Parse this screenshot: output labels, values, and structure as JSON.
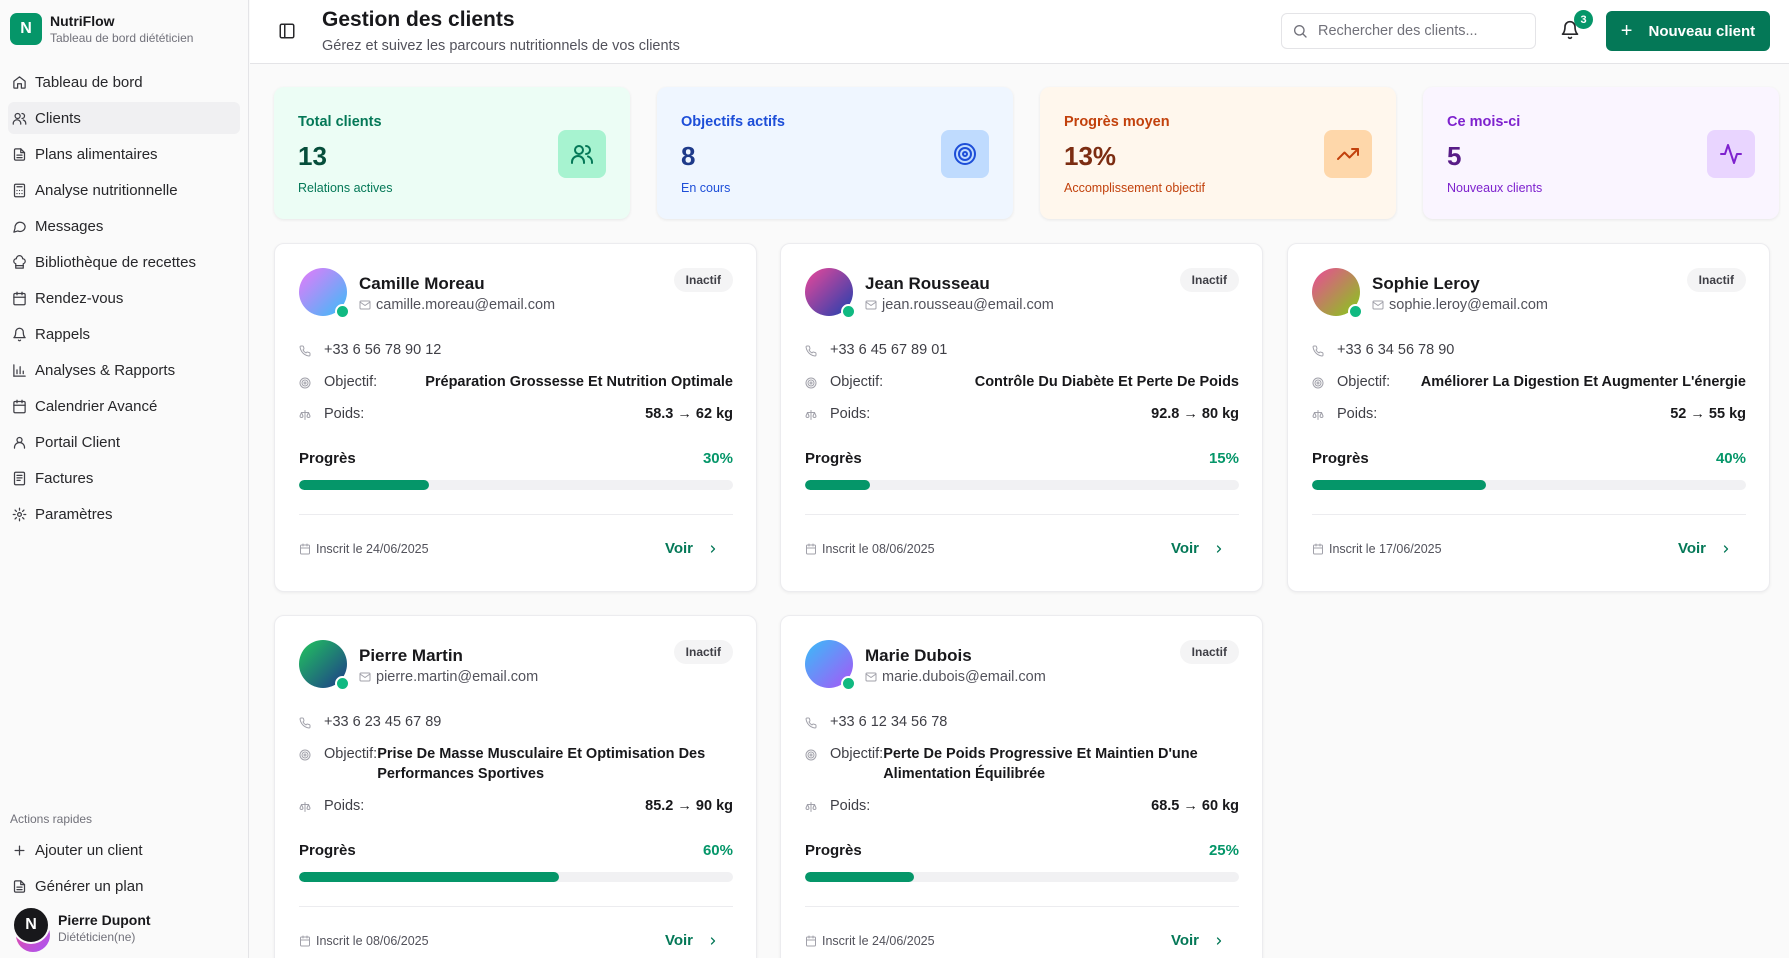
{
  "brand": {
    "logo": "N",
    "name": "NutriFlow",
    "subtitle": "Tableau de bord diététicien"
  },
  "sidebar": {
    "items": [
      {
        "label": "Tableau de bord",
        "icon": "home-icon",
        "active": false
      },
      {
        "label": "Clients",
        "icon": "users-icon",
        "active": true
      },
      {
        "label": "Plans alimentaires",
        "icon": "file-icon",
        "active": false
      },
      {
        "label": "Analyse nutritionnelle",
        "icon": "calculator-icon",
        "active": false
      },
      {
        "label": "Messages",
        "icon": "message-icon",
        "active": false
      },
      {
        "label": "Bibliothèque de recettes",
        "icon": "chef-hat-icon",
        "active": false
      },
      {
        "label": "Rendez-vous",
        "icon": "calendar-icon",
        "active": false
      },
      {
        "label": "Rappels",
        "icon": "bell-icon",
        "active": false
      },
      {
        "label": "Analyses & Rapports",
        "icon": "bar-chart-icon",
        "active": false
      },
      {
        "label": "Calendrier Avancé",
        "icon": "calendar-icon",
        "active": false
      },
      {
        "label": "Portail Client",
        "icon": "user-icon",
        "active": false
      },
      {
        "label": "Factures",
        "icon": "receipt-icon",
        "active": false
      },
      {
        "label": "Paramètres",
        "icon": "gear-icon",
        "active": false
      }
    ],
    "quick_title": "Actions rapides",
    "quick_actions": [
      {
        "label": "Ajouter un client",
        "icon": "plus-icon"
      },
      {
        "label": "Générer un plan",
        "icon": "file-icon"
      }
    ],
    "user": {
      "initial": "N",
      "name": "Pierre Dupont",
      "role": "Diététicien(ne)"
    }
  },
  "header": {
    "title": "Gestion des clients",
    "subtitle": "Gérez et suivez les parcours nutritionnels de vos clients",
    "search_placeholder": "Rechercher des clients...",
    "notif_count": "3",
    "new_button": "Nouveau client"
  },
  "stats": [
    {
      "label": "Total clients",
      "value": "13",
      "sub": "Relations actives",
      "icon": "users-icon",
      "bg": "#ecfdf5",
      "icon_bg": "#a7f3d0",
      "color": "#047857",
      "value_color": "#064e3b"
    },
    {
      "label": "Objectifs actifs",
      "value": "8",
      "sub": "En cours",
      "icon": "target-icon",
      "bg": "#eff6ff",
      "icon_bg": "#bfdbfe",
      "color": "#1d4ed8",
      "value_color": "#1e3a8a"
    },
    {
      "label": "Progrès moyen",
      "value": "13%",
      "sub": "Accomplissement objectif",
      "icon": "trending-up-icon",
      "bg": "#fff7ed",
      "icon_bg": "#fed7aa",
      "color": "#c2410c",
      "value_color": "#7c2d12"
    },
    {
      "label": "Ce mois-ci",
      "value": "5",
      "sub": "Nouveaux clients",
      "icon": "activity-icon",
      "bg": "#faf5ff",
      "icon_bg": "#e9d5ff",
      "color": "#7e22ce",
      "value_color": "#581c87"
    }
  ],
  "labels": {
    "objective": "Objectif:",
    "weight": "Poids:",
    "progress": "Progrès",
    "view": "Voir"
  },
  "clients": [
    {
      "name": "Camille Moreau",
      "email": "camille.moreau@email.com",
      "status": "Inactif",
      "phone": "+33 6 56 78 90 12",
      "objective": "Préparation Grossesse Et Nutrition Optimale",
      "weight": "58.3 → 62 kg",
      "progress": 30,
      "progress_label": "30%",
      "enrolled": "Inscrit le 24/06/2025",
      "grad": [
        "#e879f9",
        "#38bdf8"
      ]
    },
    {
      "name": "Jean Rousseau",
      "email": "jean.rousseau@email.com",
      "status": "Inactif",
      "phone": "+33 6 45 67 89 01",
      "objective": "Contrôle Du Diabète Et Perte De Poids",
      "weight": "92.8 → 80 kg",
      "progress": 15,
      "progress_label": "15%",
      "enrolled": "Inscrit le 08/06/2025",
      "grad": [
        "#ec4899",
        "#1e40af"
      ]
    },
    {
      "name": "Sophie Leroy",
      "email": "sophie.leroy@email.com",
      "status": "Inactif",
      "phone": "+33 6 34 56 78 90",
      "objective": "Améliorer La Digestion Et Augmenter L'énergie",
      "weight": "52 → 55 kg",
      "progress": 40,
      "progress_label": "40%",
      "enrolled": "Inscrit le 17/06/2025",
      "grad": [
        "#ec4899",
        "#84cc16"
      ]
    },
    {
      "name": "Pierre Martin",
      "email": "pierre.martin@email.com",
      "status": "Inactif",
      "phone": "+33 6 23 45 67 89",
      "objective": "Prise De Masse Musculaire Et Optimisation Des Performances Sportives",
      "weight": "85.2 → 90 kg",
      "progress": 60,
      "progress_label": "60%",
      "enrolled": "Inscrit le 08/06/2025",
      "grad": [
        "#22c55e",
        "#1e3a8a"
      ]
    },
    {
      "name": "Marie Dubois",
      "email": "marie.dubois@email.com",
      "status": "Inactif",
      "phone": "+33 6 12 34 56 78",
      "objective": "Perte De Poids Progressive Et Maintien D'une Alimentation Équilibrée",
      "weight": "68.5 → 60 kg",
      "progress": 25,
      "progress_label": "25%",
      "enrolled": "Inscrit le 24/06/2025",
      "grad": [
        "#38bdf8",
        "#a855f7"
      ]
    }
  ]
}
